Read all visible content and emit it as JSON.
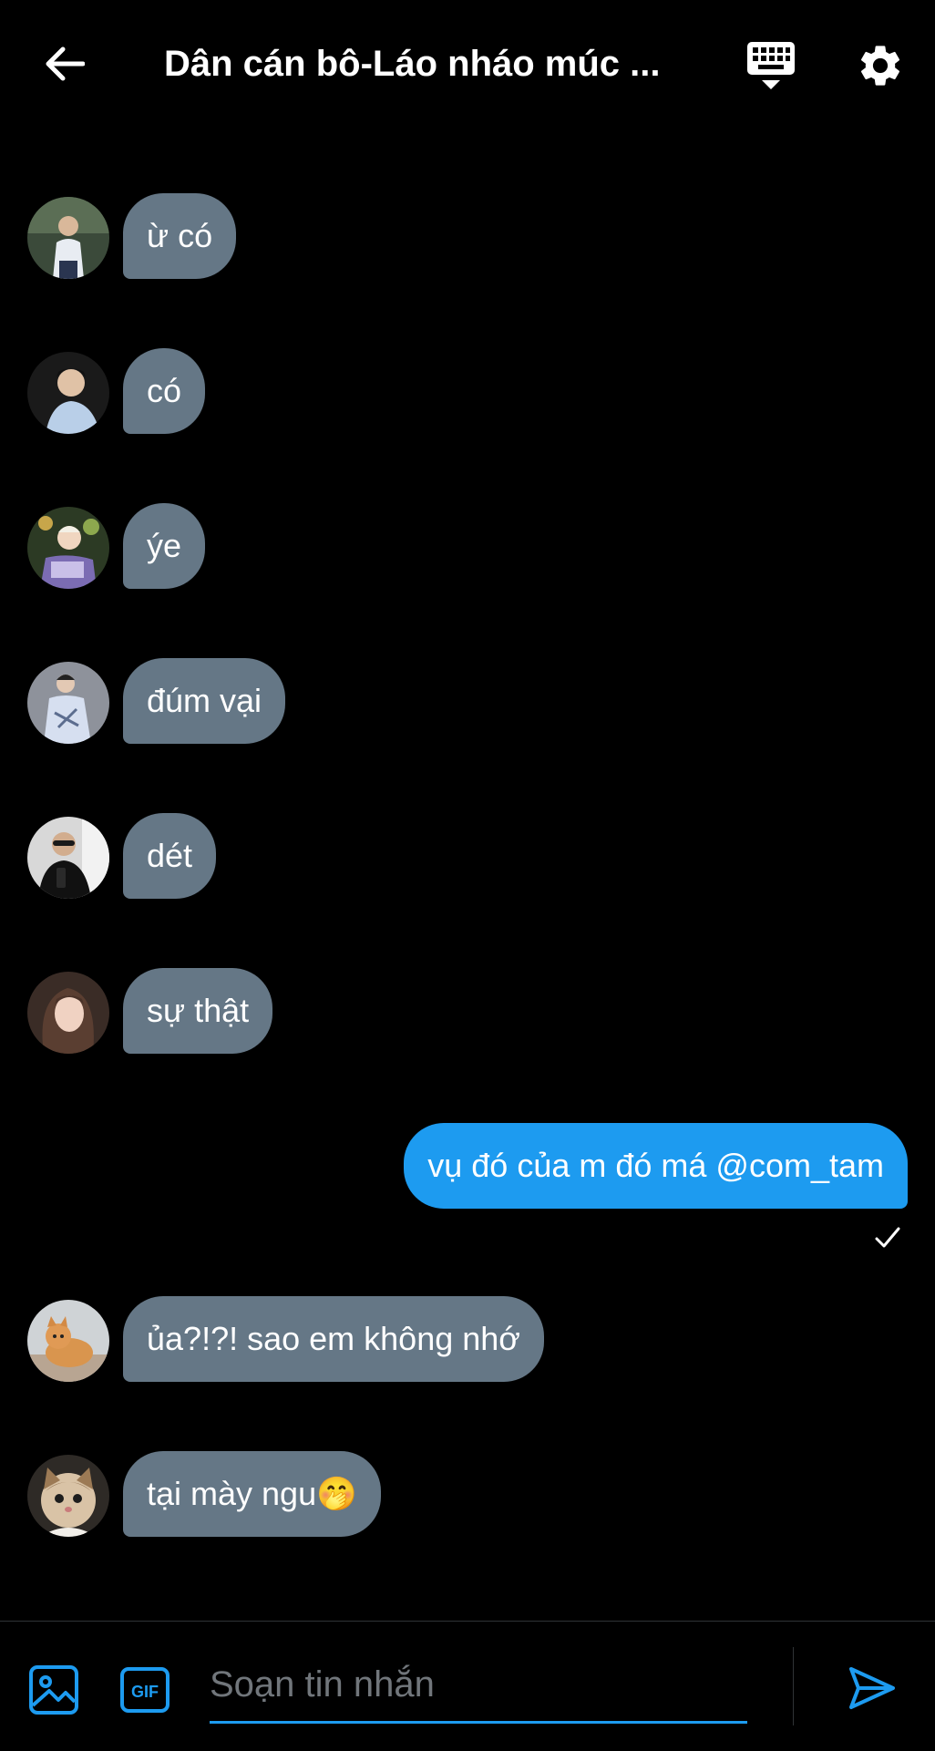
{
  "header": {
    "title": "Dân cán bô-Láo nháo múc ...",
    "back_icon": "arrow-left-icon",
    "keyboard_icon": "keyboard-icon",
    "settings_icon": "gear-icon"
  },
  "messages": [
    {
      "sender": "other",
      "text": "ừ có"
    },
    {
      "sender": "other",
      "text": "có"
    },
    {
      "sender": "other",
      "text": "ýe"
    },
    {
      "sender": "other",
      "text": "đúm vại"
    },
    {
      "sender": "other",
      "text": "dét"
    },
    {
      "sender": "other",
      "text": "sự thật"
    },
    {
      "sender": "self",
      "text": "vụ đó của m đó má @com_tam"
    },
    {
      "sender": "other",
      "text": "ủa?!?! sao em không nhớ"
    },
    {
      "sender": "other",
      "text": "tại mày ngu🤭"
    }
  ],
  "composer": {
    "placeholder": "Soạn tin nhắn",
    "value": "",
    "image_icon": "image-icon",
    "gif_label": "GIF",
    "send_icon": "send-icon"
  },
  "colors": {
    "background": "#000000",
    "incoming_bubble": "#657786",
    "outgoing_bubble": "#1d9bf0",
    "accent": "#1d9bf0",
    "placeholder": "#71767b"
  }
}
